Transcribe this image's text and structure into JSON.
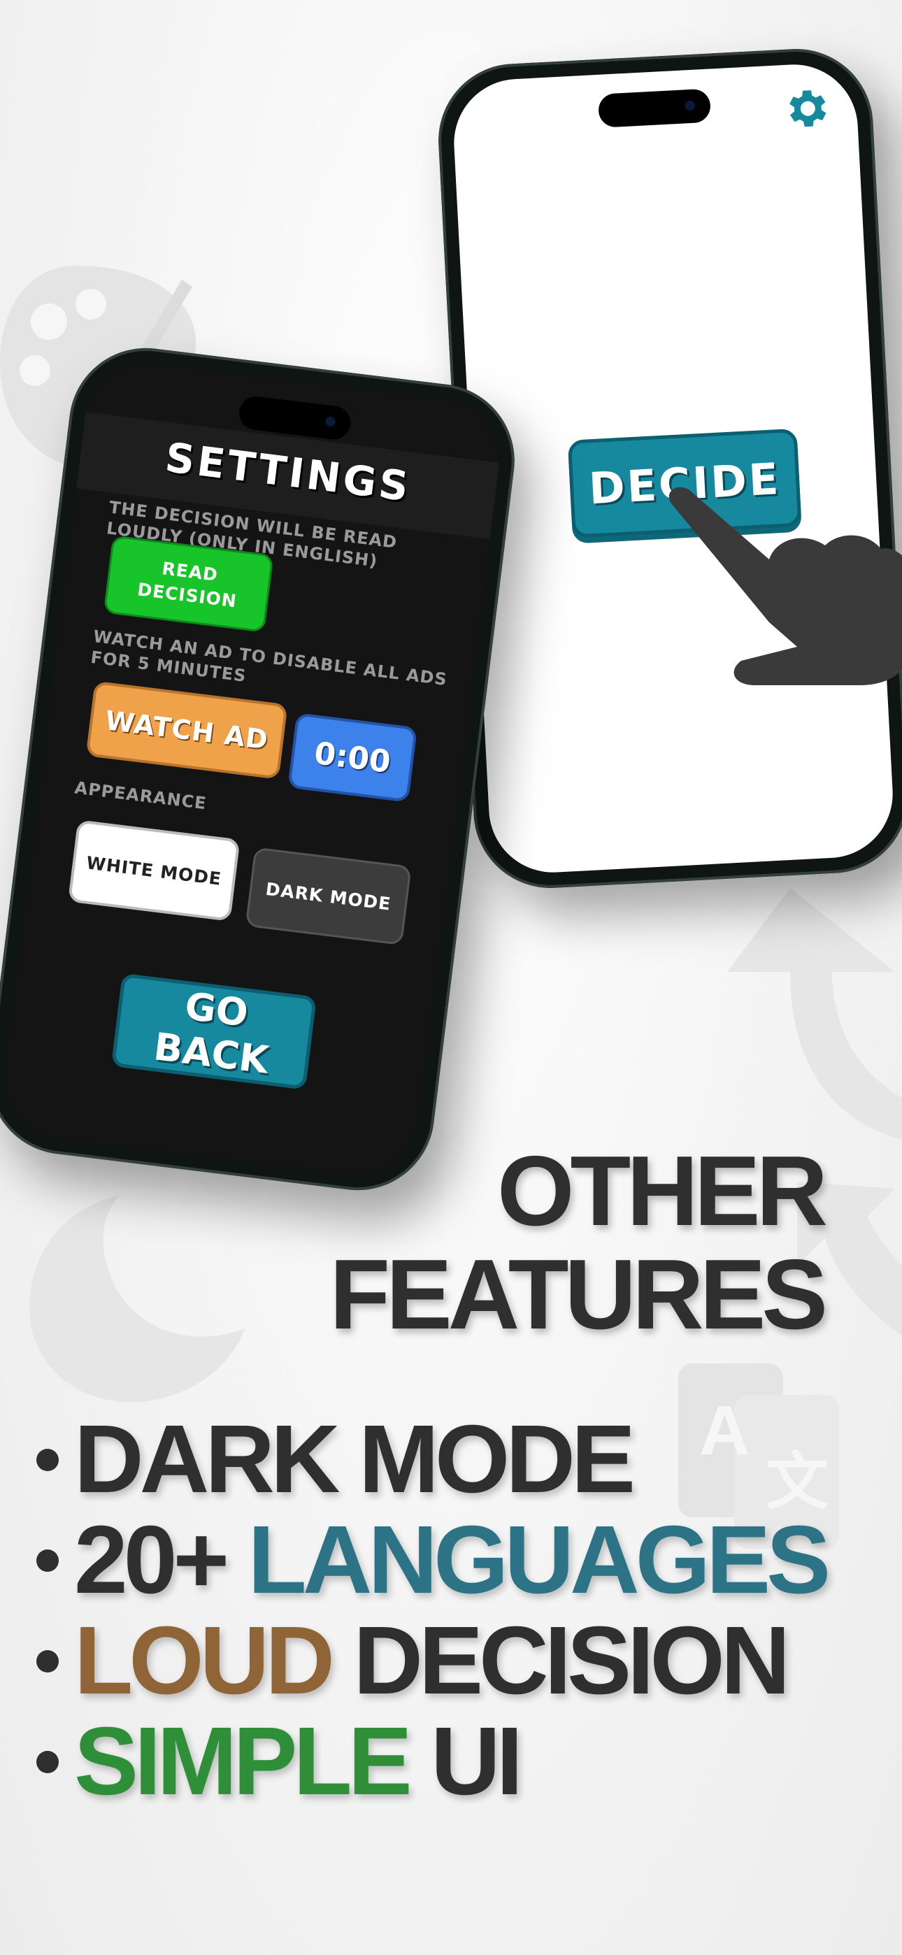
{
  "right_phone": {
    "decide_label": "DECIDE",
    "settings_icon": "gear-icon"
  },
  "settings_screen": {
    "title": "SETTINGS",
    "read_label": "THE DECISION WILL BE READ LOUDLY (ONLY IN ENGLISH)",
    "read_button": "READ DECISION",
    "ad_label": "WATCH AN AD TO DISABLE ALL ADS FOR 5 MINUTES",
    "watch_button": "WATCH AD",
    "timer": "0:00",
    "appearance_label": "APPEARANCE",
    "white_mode": "WHITE MODE",
    "dark_mode": "DARK MODE",
    "go_back": "GO BACK"
  },
  "headline": {
    "line1": "OTHER",
    "line2": "FEATURES"
  },
  "features": {
    "f1": "DARK MODE",
    "f2a": "20+ ",
    "f2b": "LANGUAGES",
    "f3a": "LOUD",
    "f3b": " DECISION",
    "f4a": "SIMPLE",
    "f4b": " UI"
  },
  "colors": {
    "accent_teal": "#17899e",
    "languages_blue": "#2c7485",
    "loud_brown": "#8f6538",
    "simple_green": "#2f8f39",
    "text_dark": "#2f2f2f"
  }
}
